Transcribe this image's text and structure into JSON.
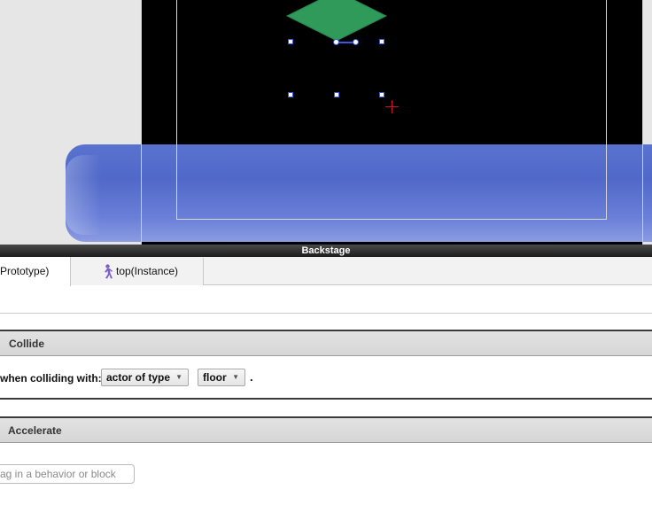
{
  "backstage": {
    "title": "Backstage"
  },
  "tabs": [
    {
      "label": "Prototype)",
      "active": true
    },
    {
      "label": "top(Instance)",
      "icon": "walker-icon",
      "active": false
    }
  ],
  "behaviors": {
    "collide": {
      "header": "Collide",
      "condition_label": "when colliding with:",
      "target_type": "actor of type",
      "target_actor": "floor",
      "terminator": "."
    },
    "accelerate": {
      "header": "Accelerate"
    }
  },
  "search": {
    "placeholder": "ag in a behavior or block"
  },
  "colors": {
    "stage": "#000000",
    "floor_blue": "#5068c8",
    "diamond_green": "#2f9a5a",
    "selection_blue": "#3a5be0",
    "origin_red": "#d0102a"
  }
}
